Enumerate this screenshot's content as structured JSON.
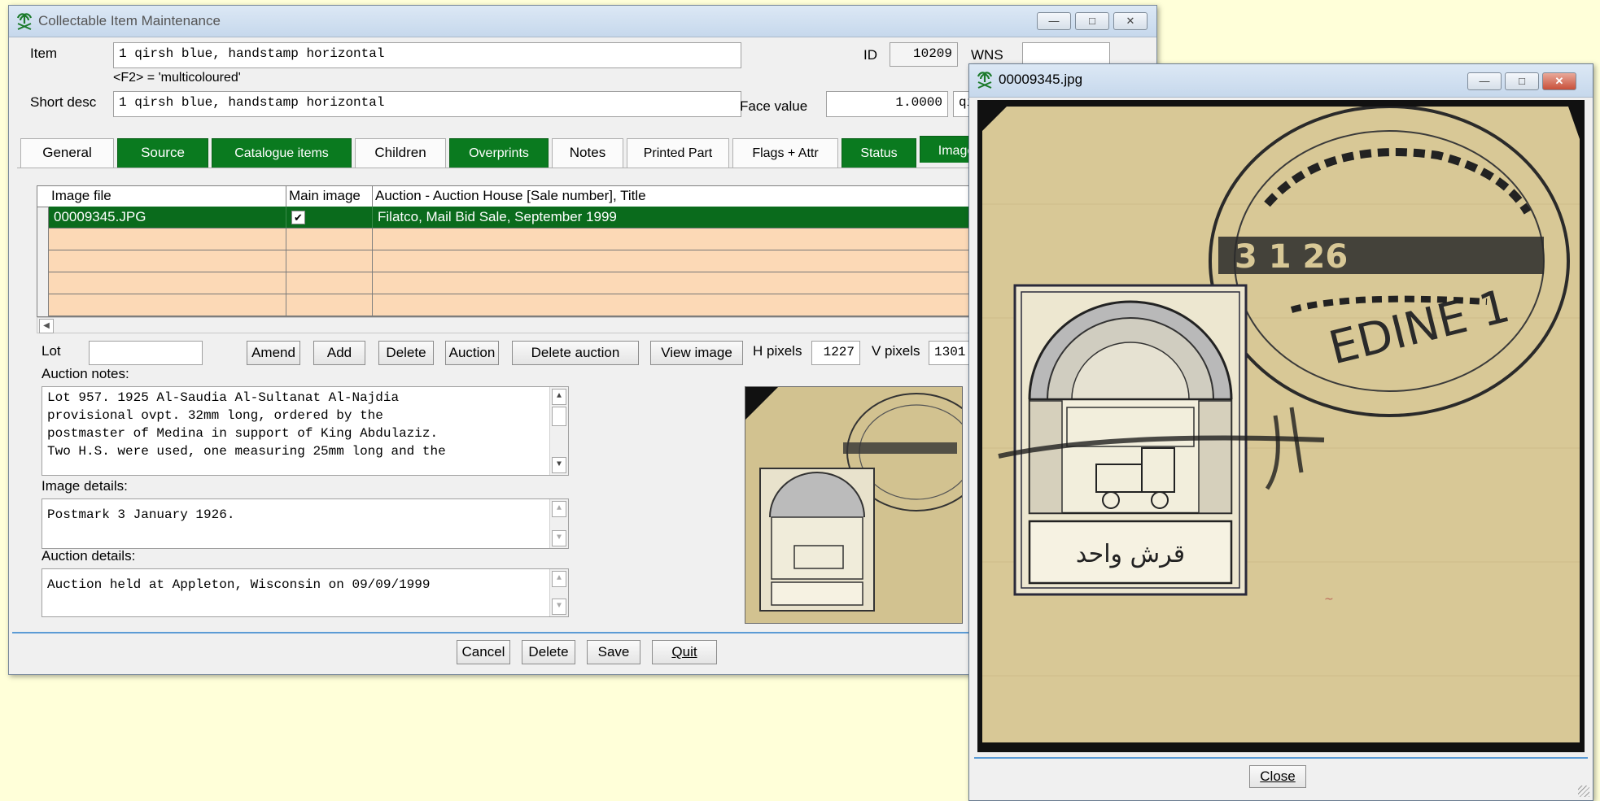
{
  "main_window": {
    "title": "Collectable Item Maintenance",
    "item_label": "Item",
    "item_value": "1 qirsh blue, handstamp horizontal",
    "f2_hint": "<F2> = 'multicoloured'",
    "id_label": "ID",
    "id_value": "10209",
    "wns_label": "WNS",
    "wns_value": "",
    "short_desc_label": "Short desc",
    "short_desc_value": "1 qirsh blue, handstamp horizontal",
    "face_value_label": "Face value",
    "face_value": "1.0000",
    "face_unit": "qi",
    "tabs": [
      {
        "label": "General",
        "style": "plain"
      },
      {
        "label": "Source",
        "style": "green"
      },
      {
        "label": "Catalogue items",
        "style": "green"
      },
      {
        "label": "Children",
        "style": "plain"
      },
      {
        "label": "Overprints",
        "style": "green"
      },
      {
        "label": "Notes",
        "style": "plain"
      },
      {
        "label": "Printed Part",
        "style": "plain"
      },
      {
        "label": "Flags + Attr",
        "style": "plain"
      },
      {
        "label": "Status",
        "style": "green"
      },
      {
        "label": "Image",
        "style": "green"
      }
    ],
    "grid": {
      "columns": [
        "Image file",
        "Main image",
        "Auction - Auction House [Sale number], Title"
      ],
      "rows": [
        {
          "file": "00009345.JPG",
          "main": true,
          "auction": "Filatco, Mail Bid Sale, September 1999"
        }
      ]
    },
    "lot_label": "Lot",
    "lot_value": "",
    "buttons": {
      "amend": "Amend",
      "add": "Add",
      "delete": "Delete",
      "auction": "Auction",
      "delete_auction": "Delete auction",
      "view_image": "View image"
    },
    "h_pixels_label": "H pixels",
    "h_pixels_value": "1227",
    "v_pixels_label": "V pixels",
    "v_pixels_value": "1301",
    "auction_notes_label": "Auction notes:",
    "auction_notes_lines": [
      "Lot 957. 1925 Al-Saudia Al-Sultanat Al-Najdia",
      "provisional ovpt. 32mm long, ordered by the",
      "postmaster of Medina in support of King Abdulaziz.",
      "Two H.S. were used, one measuring 25mm long and the"
    ],
    "image_details_label": "Image details:",
    "image_details_value": "Postmark 3 January 1926.",
    "auction_details_label": "Auction details:",
    "auction_details_value": "Auction held at Appleton, Wisconsin on 09/09/1999",
    "bottom_buttons": {
      "cancel": "Cancel",
      "delete": "Delete",
      "save": "Save",
      "quit": "Quit"
    }
  },
  "image_window": {
    "title": "00009345.jpg",
    "close_label": "Close"
  },
  "stamp_text": {
    "postmark_date": "3 1 26",
    "postmark_city": "EDINE 1",
    "value_arabic": "قرش واحد"
  },
  "colors": {
    "tab_green": "#0a7a1f",
    "grid_selected": "#0a6b1c",
    "grid_empty_row": "#fcd9b6",
    "paper": "#d8c896",
    "desktop": "#ffffd9"
  }
}
